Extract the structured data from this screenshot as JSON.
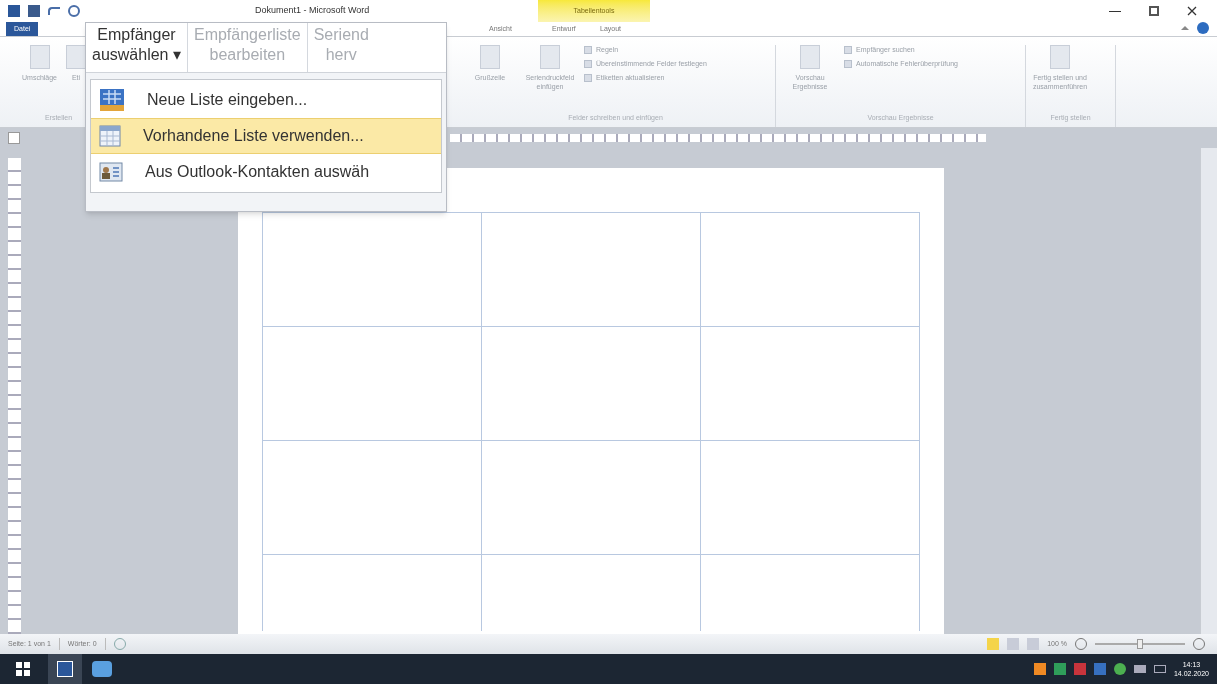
{
  "window": {
    "title": "Dokument1 - Microsoft Word"
  },
  "tabs": [
    {
      "label": "Datei",
      "selected": false,
      "kind": "file"
    },
    {
      "label": "Ansicht",
      "selected": false,
      "kind": "tab"
    },
    {
      "label": "Entwurf",
      "selected": false,
      "kind": "tab"
    },
    {
      "label": "Layout",
      "selected": false,
      "kind": "tab"
    }
  ],
  "contextual_tab": {
    "label": "Tabellentools"
  },
  "ribbon": {
    "groups": [
      {
        "label": "Erstellen",
        "items": [
          {
            "label": "Umschläge",
            "kind": "large"
          },
          {
            "label": "Eti",
            "kind": "large"
          }
        ]
      },
      {
        "label": "Felder schreiben und einfügen",
        "items": [
          {
            "label": "Grußzeile",
            "kind": "large"
          },
          {
            "label": "Seriendruckfeld einfügen",
            "kind": "large"
          },
          {
            "label": "Regeln",
            "kind": "small"
          },
          {
            "label": "Übereinstimmende Felder festlegen",
            "kind": "small"
          },
          {
            "label": "Etiketten aktualisieren",
            "kind": "small"
          }
        ]
      },
      {
        "label": "Vorschau Ergebnisse",
        "items": [
          {
            "label": "Vorschau Ergebnisse",
            "kind": "large"
          },
          {
            "label": "Empfänger suchen",
            "kind": "small"
          },
          {
            "label": "Automatische Fehlerüberprüfung",
            "kind": "small"
          }
        ]
      },
      {
        "label": "Fertig stellen",
        "items": [
          {
            "label": "Fertig stellen und zusammenführen",
            "kind": "large"
          }
        ]
      }
    ]
  },
  "popup": {
    "buttons": [
      {
        "label": "Empfänger",
        "label2": "auswählen",
        "disabled": false,
        "arrow": "▾"
      },
      {
        "label": "Empfängerliste",
        "label2": "bearbeiten",
        "disabled": true
      },
      {
        "label": "Seriend",
        "label2": "herv",
        "disabled": true
      }
    ],
    "menu": [
      {
        "label": "Neue Liste eingeben...",
        "selected": false,
        "kind": "new-list"
      },
      {
        "label": "Vorhandene Liste verwenden...",
        "selected": true,
        "kind": "existing-list"
      },
      {
        "label": "Aus Outlook-Kontakten auswäh",
        "selected": false,
        "kind": "contacts"
      }
    ]
  },
  "status_bar": {
    "page": "Seite: 1 von 1",
    "words": "Wörter: 0",
    "zoom": "100 %"
  },
  "taskbar": {
    "time": "14:13",
    "date": "14.02.2020"
  }
}
